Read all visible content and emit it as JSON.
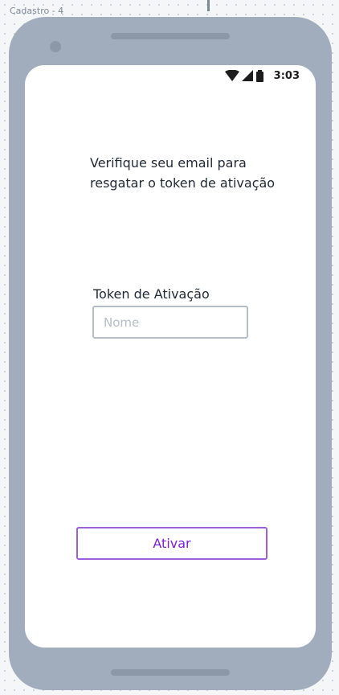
{
  "frame": {
    "label": "Cadastro - 4"
  },
  "status_bar": {
    "time": "3:03",
    "icons": [
      "wifi-icon",
      "signal-icon",
      "battery-icon"
    ]
  },
  "content": {
    "instruction": "Verifique seu email para resgatar o token de ativação",
    "token_label": "Token de Ativação",
    "token_placeholder": "Nome",
    "token_value": "",
    "activate_label": "Ativar"
  },
  "colors": {
    "phone_body": "#a1adbc",
    "screen": "#ffffff",
    "text": "#222a36",
    "input_border": "#b5bdc7",
    "button_border": "#9a5fd9",
    "button_text": "#7a1fd6"
  }
}
